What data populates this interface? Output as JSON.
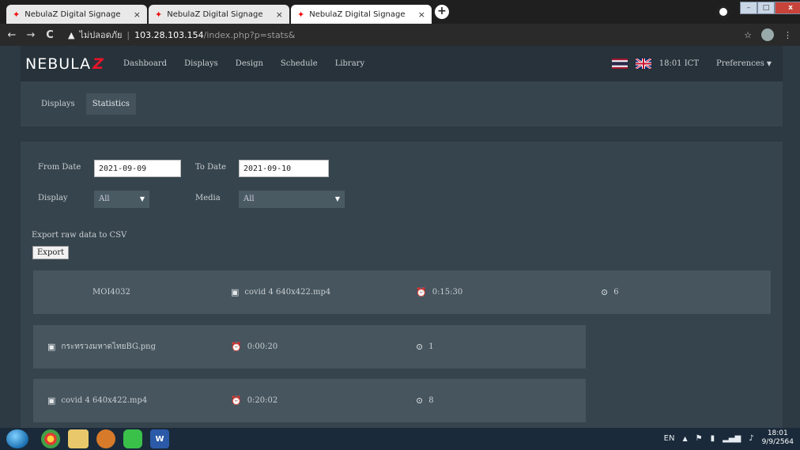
{
  "browser": {
    "tabs": [
      {
        "title": "NebulaZ Digital Signage",
        "close": "×"
      },
      {
        "title": "NebulaZ Digital Signage",
        "close": "×"
      },
      {
        "title": "NebulaZ Digital Signage",
        "close": "×"
      }
    ],
    "new_tab": "+",
    "window_controls": {
      "minimize": "–",
      "maximize": "□",
      "close": "x"
    },
    "nav": {
      "back": "←",
      "forward": "→",
      "reload": "C"
    },
    "security_warning": "▲",
    "insecure_label": "ไม่ปลอดภัย",
    "url_host": "103.28.103.154",
    "url_path": "/index.php?p=stats&",
    "bookmark_star": "☆",
    "menu_dots": "⋮"
  },
  "app": {
    "logo_text": "NEBULA",
    "logo_z": "Z",
    "menu": [
      "Dashboard",
      "Displays",
      "Design",
      "Schedule",
      "Library"
    ],
    "time": "18:01 ICT",
    "preferences": "Preferences",
    "subtabs": [
      {
        "label": "Displays",
        "active": false
      },
      {
        "label": "Statistics",
        "active": true
      }
    ],
    "filters": {
      "from_label": "From Date",
      "from_value": "2021-09-09",
      "to_label": "To Date",
      "to_value": "2021-09-10",
      "display_label": "Display",
      "display_value": "All",
      "media_label": "Media",
      "media_value": "All"
    },
    "export": {
      "label": "Export raw data to CSV",
      "button": "Export"
    },
    "summary": {
      "display": "MOI4032",
      "media": "covid 4 640x422.mp4",
      "duration": "0:15:30",
      "count": "6"
    },
    "rows": [
      {
        "media": "กระทรวงมหาดไทยBG.png",
        "duration": "0:00:20",
        "count": "1"
      },
      {
        "media": "covid 4 640x422.mp4",
        "duration": "0:20:02",
        "count": "8"
      }
    ]
  },
  "taskbar": {
    "language": "EN",
    "tray_up": "▲",
    "clock_time": "18:01",
    "clock_date": "9/9/2564"
  },
  "colors": {
    "accent": "#e5152b",
    "nav_bg": "#27323a",
    "panel_bg": "#36444d",
    "card_bg": "#46555e"
  }
}
